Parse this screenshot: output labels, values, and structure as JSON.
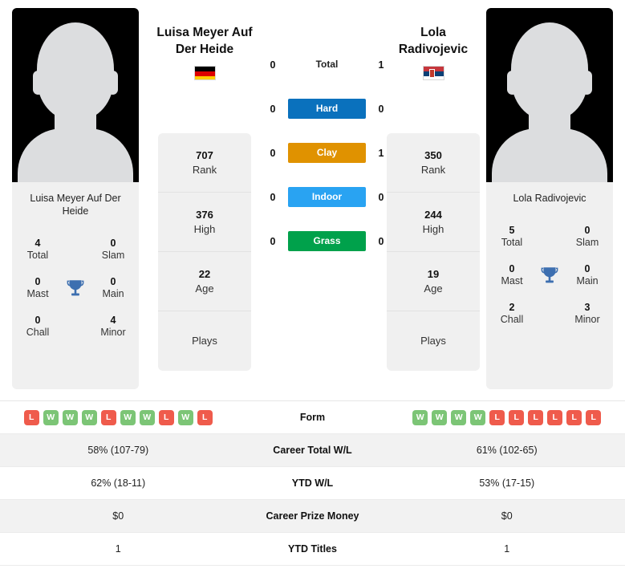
{
  "players": {
    "left": {
      "display_name": "Luisa Meyer Auf Der Heide",
      "header_name_line1": "Luisa Meyer Auf",
      "header_name_line2": "Der Heide",
      "country": "Germany",
      "flag_icon": "flag-germany-icon",
      "avatar_icon": "player-avatar-placeholder-icon",
      "titles": {
        "total_value": "4",
        "total_label": "Total",
        "slam_value": "0",
        "slam_label": "Slam",
        "mast_value": "0",
        "mast_label": "Mast",
        "main_value": "0",
        "main_label": "Main",
        "chall_value": "0",
        "chall_label": "Chall",
        "minor_value": "4",
        "minor_label": "Minor",
        "trophy_icon": "trophy-icon"
      },
      "ranking": [
        {
          "value": "707",
          "label": "Rank"
        },
        {
          "value": "376",
          "label": "High"
        },
        {
          "value": "22",
          "label": "Age"
        },
        {
          "value": "",
          "label": "Plays"
        }
      ],
      "form": [
        "L",
        "W",
        "W",
        "W",
        "L",
        "W",
        "W",
        "L",
        "W",
        "L"
      ],
      "career_total_wl": "58% (107-79)",
      "ytd_wl": "62% (18-11)",
      "career_prize_money": "$0",
      "ytd_titles": "1"
    },
    "right": {
      "display_name": "Lola Radivojevic",
      "header_name_line1": "Lola",
      "header_name_line2": "Radivojevic",
      "country": "Serbia",
      "flag_icon": "flag-serbia-icon",
      "avatar_icon": "player-avatar-placeholder-icon",
      "titles": {
        "total_value": "5",
        "total_label": "Total",
        "slam_value": "0",
        "slam_label": "Slam",
        "mast_value": "0",
        "mast_label": "Mast",
        "main_value": "0",
        "main_label": "Main",
        "chall_value": "2",
        "chall_label": "Chall",
        "minor_value": "3",
        "minor_label": "Minor",
        "trophy_icon": "trophy-icon"
      },
      "ranking": [
        {
          "value": "350",
          "label": "Rank"
        },
        {
          "value": "244",
          "label": "High"
        },
        {
          "value": "19",
          "label": "Age"
        },
        {
          "value": "",
          "label": "Plays"
        }
      ],
      "form": [
        "W",
        "W",
        "W",
        "W",
        "L",
        "L",
        "L",
        "L",
        "L",
        "L"
      ],
      "career_total_wl": "61% (102-65)",
      "ytd_wl": "53% (17-15)",
      "career_prize_money": "$0",
      "ytd_titles": "1"
    }
  },
  "head_to_head": [
    {
      "label": "Total",
      "left": "0",
      "right": "1",
      "color": "transparent",
      "text_color": "#222222"
    },
    {
      "label": "Hard",
      "left": "0",
      "right": "0",
      "color": "#0a71bd",
      "text_color": "#ffffff"
    },
    {
      "label": "Clay",
      "left": "0",
      "right": "1",
      "color": "#e09200",
      "text_color": "#ffffff"
    },
    {
      "label": "Indoor",
      "left": "0",
      "right": "0",
      "color": "#29a3f2",
      "text_color": "#ffffff"
    },
    {
      "label": "Grass",
      "left": "0",
      "right": "0",
      "color": "#00a14b",
      "text_color": "#ffffff"
    }
  ],
  "stats_rows": [
    {
      "label": "Form",
      "left": "",
      "right": "",
      "type": "badges"
    },
    {
      "label": "Career Total W/L",
      "left": "58% (107-79)",
      "right": "61% (102-65)",
      "type": "text"
    },
    {
      "label": "YTD W/L",
      "left": "62% (18-11)",
      "right": "53% (17-15)",
      "type": "text"
    },
    {
      "label": "Career Prize Money",
      "left": "$0",
      "right": "$0",
      "type": "text"
    },
    {
      "label": "YTD Titles",
      "left": "1",
      "right": "1",
      "type": "text"
    }
  ],
  "colors": {
    "hard": "#0a71bd",
    "clay": "#e09200",
    "indoor": "#29a3f2",
    "grass": "#00a14b",
    "win": "#7cc576",
    "loss": "#ef5b4c",
    "trophy": "#3d6fb0",
    "panel_bg": "#f0f0f0"
  }
}
